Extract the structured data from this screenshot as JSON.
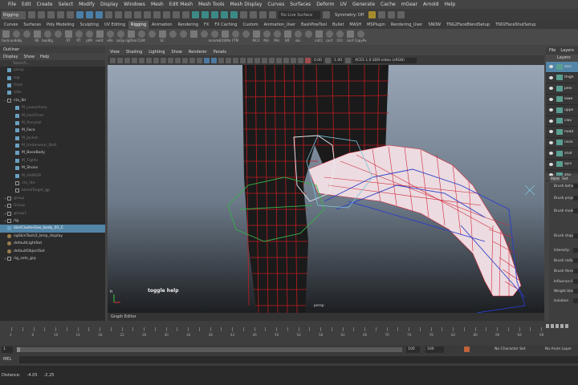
{
  "menubar": {
    "items": [
      "File",
      "Edit",
      "Create",
      "Select",
      "Modify",
      "Display",
      "Windows",
      "Mesh",
      "Edit Mesh",
      "Mesh Tools",
      "Mesh Display",
      "Curves",
      "Surfaces",
      "Deform",
      "UV",
      "Generate",
      "Cache",
      "mGear",
      "Arnold",
      "Help"
    ]
  },
  "status_line": {
    "mode": "Rigging",
    "live_surface": "No Live Surface",
    "symmetry": "Symmetry: Off"
  },
  "shelf_tabs": [
    "Curves",
    "Surfaces",
    "Poly Modeling",
    "Sculpting",
    "UV Editing",
    "Rigging",
    "Animation",
    "Rendering",
    "FX",
    "FX Caching",
    "Custom",
    "Animation_User",
    "BashPowTool",
    "Bullet",
    "MASH",
    "MSPlugin",
    "Rendering_User",
    "SNOW",
    "TNG2FaceBlendSetup",
    "TN02FaceShutSetup"
  ],
  "shelf_active_tab": "Rigging",
  "shelf_labels": [
    "tools",
    "undoKy",
    "",
    "RE",
    "boolKg",
    "",
    "RT",
    "RT",
    "ptM",
    "eeUt",
    "ePo",
    "saGp",
    "rigRhol",
    "CUM",
    "",
    "SC",
    "",
    "",
    "",
    "",
    "rename",
    "Crtl/Mo",
    "FTM",
    "",
    "MCrl",
    "Mrc",
    "Mrc",
    "WF",
    "olo",
    "",
    "intCt",
    "conf",
    "Ctrl",
    "conf",
    "CopyPe"
  ],
  "outliner": {
    "title": "Outliner",
    "menu": [
      "Display",
      "Show",
      "Help"
    ],
    "search_placeholder": "Search...",
    "items": [
      {
        "label": "persp",
        "dim": true,
        "kind": "mesh",
        "indent": 0,
        "exp": ""
      },
      {
        "label": "top",
        "dim": true,
        "kind": "mesh",
        "indent": 0,
        "exp": ""
      },
      {
        "label": "front",
        "dim": true,
        "kind": "mesh",
        "indent": 0,
        "exp": ""
      },
      {
        "label": "side",
        "dim": true,
        "kind": "mesh",
        "indent": 0,
        "exp": ""
      },
      {
        "label": "ctx_Ibl",
        "dim": false,
        "kind": "grp",
        "indent": 0,
        "exp": "−"
      },
      {
        "label": "M_LowerHose",
        "dim": true,
        "kind": "mesh",
        "indent": 1,
        "exp": ""
      },
      {
        "label": "M_HairFront",
        "dim": true,
        "kind": "mesh",
        "indent": 1,
        "exp": ""
      },
      {
        "label": "M_Ponytail",
        "dim": true,
        "kind": "mesh",
        "indent": 1,
        "exp": ""
      },
      {
        "label": "M_Face",
        "dim": false,
        "kind": "mesh",
        "indent": 1,
        "exp": ""
      },
      {
        "label": "M_Jacket",
        "dim": true,
        "kind": "mesh",
        "indent": 1,
        "exp": ""
      },
      {
        "label": "M_Underwear_Bott",
        "dim": true,
        "kind": "mesh",
        "indent": 1,
        "exp": ""
      },
      {
        "label": "M_BaseBody",
        "dim": false,
        "kind": "mesh",
        "indent": 1,
        "exp": ""
      },
      {
        "label": "M_Tights",
        "dim": true,
        "kind": "mesh",
        "indent": 1,
        "exp": ""
      },
      {
        "label": "M_Shoes",
        "dim": false,
        "kind": "mesh",
        "indent": 1,
        "exp": ""
      },
      {
        "label": "M_HAIRGR",
        "dim": true,
        "kind": "mesh",
        "indent": 1,
        "exp": ""
      },
      {
        "label": "ctx_lite",
        "dim": true,
        "kind": "grp",
        "indent": 1,
        "exp": ""
      },
      {
        "label": "blendTarget_gp",
        "dim": true,
        "kind": "grp",
        "indent": 1,
        "exp": ""
      },
      {
        "label": "group",
        "dim": true,
        "kind": "grp",
        "indent": 0,
        "exp": "+"
      },
      {
        "label": "Group",
        "dim": true,
        "kind": "grp",
        "indent": 0,
        "exp": "+"
      },
      {
        "label": "group1",
        "dim": true,
        "kind": "grp",
        "indent": 0,
        "exp": "+"
      },
      {
        "label": "rig",
        "dim": false,
        "kind": "grp",
        "indent": 0,
        "exp": "+"
      },
      {
        "label": "skinClusterGeo_body_01_C",
        "dim": false,
        "kind": "mesh",
        "indent": 0,
        "exp": "",
        "selected": true
      },
      {
        "label": "ngSkinTools2_bmp_display",
        "dim": false,
        "kind": "set",
        "indent": 0,
        "exp": ""
      },
      {
        "label": "defaultLightSet",
        "dim": false,
        "kind": "set",
        "indent": 0,
        "exp": ""
      },
      {
        "label": "defaultObjectSet",
        "dim": false,
        "kind": "set",
        "indent": 0,
        "exp": ""
      },
      {
        "label": "rig_sets_grp",
        "dim": false,
        "kind": "grp",
        "indent": 0,
        "exp": "+"
      }
    ]
  },
  "viewport": {
    "menu": [
      "View",
      "Shading",
      "Lighting",
      "Show",
      "Renderer",
      "Panels"
    ],
    "num_a": "0.00",
    "num_b": "1.00",
    "ocio": "ACES 1.0 SDR-video (sRGB)",
    "toggle_help": "toggle help",
    "camera": "persp",
    "axis_label": "h"
  },
  "graph_editor": "Graph Editor",
  "right_tabs": [
    "File",
    "Layers"
  ],
  "layers": {
    "title": "Layers",
    "items": [
      "skin",
      "thigh",
      "pelv",
      "lowe",
      "uppe",
      "clav",
      "head",
      "neck",
      "shaf",
      "spin",
      "sho"
    ]
  },
  "paint_tool": {
    "tabs": [
      "Paint",
      "Set"
    ],
    "labels": [
      "Brush behav",
      "Brush proje",
      "Brush mode",
      "Brush shape",
      "Intensity:",
      "Brush radius",
      "Brush thresh",
      "Influence li",
      "Weight blend",
      "Isolation"
    ]
  },
  "time_slider": {
    "ticks": [
      "2",
      "",
      "6",
      "",
      "10",
      "",
      "14",
      "",
      "18",
      "",
      "22",
      "",
      "26",
      "",
      "30",
      "",
      "34",
      "",
      "38",
      "",
      "42",
      "",
      "46",
      "",
      "50",
      "",
      "54",
      "",
      "58",
      "",
      "62",
      "",
      "66",
      "",
      "70",
      "",
      "74",
      "",
      "78",
      "",
      "82",
      "",
      "86",
      "",
      "90",
      "",
      "94",
      "",
      "98"
    ],
    "current": "1"
  },
  "range_slider": {
    "start": "1",
    "inner_end": "100",
    "end": "100",
    "character_set": "No Character Set",
    "anim_layer": "No Anim Layer",
    "fps_hint": ""
  },
  "command_line": {
    "label": "MEL"
  },
  "help_line": {
    "items": [
      "Distance:",
      "-4.05",
      "-2.25"
    ]
  }
}
